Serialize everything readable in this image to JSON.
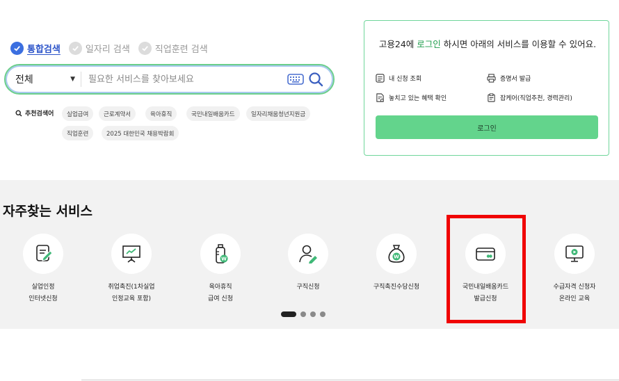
{
  "search_tabs": [
    {
      "label": "통합검색",
      "active": true
    },
    {
      "label": "일자리 검색",
      "active": false
    },
    {
      "label": "직업훈련 검색",
      "active": false
    }
  ],
  "search": {
    "category": "전체",
    "placeholder": "필요한 서비스를 찾아보세요"
  },
  "popular": {
    "label": "추천검색어",
    "keywords": [
      "실업급여",
      "근로계약서",
      "육아휴직",
      "국민내일배움카드",
      "일자리채움청년지원금",
      "직업훈련",
      "2025 대한민국 채용박람회"
    ]
  },
  "login": {
    "message_prefix": "고용24에 ",
    "message_link": "로그인",
    "message_suffix": " 하시면 아래의 서비스를 이용할 수 있어요.",
    "links": [
      "내 신청 조회",
      "증명서 발급",
      "놓치고 있는 혜택 확인",
      "잡케어(직업추천, 경력관리)"
    ],
    "button_label": "로그인"
  },
  "services": {
    "title": "자주찾는 서비스",
    "items": [
      {
        "label": "실업인정\n인터넷신청",
        "icon": "document-edit-icon"
      },
      {
        "label": "취업촉진(1차실업\n인정교육 포함)",
        "icon": "presentation-board-icon"
      },
      {
        "label": "육아휴직\n급여 신청",
        "icon": "baby-bottle-won-icon"
      },
      {
        "label": "구직신청",
        "icon": "person-edit-icon"
      },
      {
        "label": "구직촉진수당신청",
        "icon": "money-bag-won-icon"
      },
      {
        "label": "국민내일배움카드\n발급신청",
        "icon": "card-icon"
      },
      {
        "label": "수급자격 신청자\n온라인 교육",
        "icon": "monitor-play-icon"
      }
    ],
    "highlighted_index": 5,
    "pager": {
      "total": 4,
      "active": 1
    }
  },
  "colors": {
    "accent_green": "#63d48c",
    "accent_blue": "#3b6fe0",
    "highlight_red": "#f00404"
  }
}
